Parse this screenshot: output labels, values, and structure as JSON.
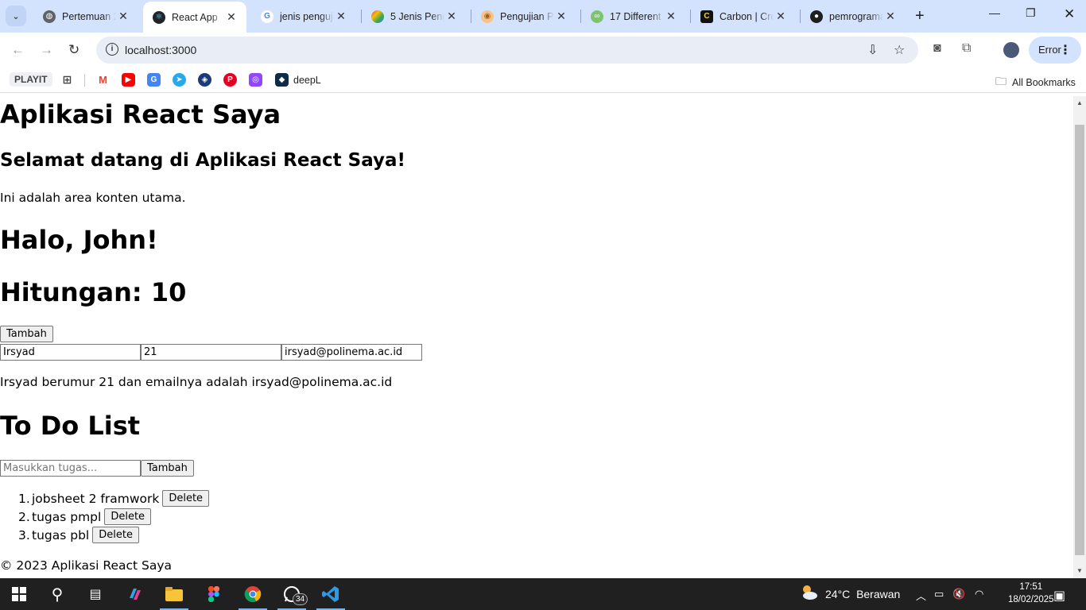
{
  "browser": {
    "tabs": [
      {
        "title": "Pertemuan 2",
        "favicon": "globe-icon",
        "active": false
      },
      {
        "title": "React App",
        "favicon": "react-icon",
        "active": true
      },
      {
        "title": "jenis penguji",
        "favicon": "google-icon",
        "active": false
      },
      {
        "title": "5 Jenis Peng",
        "favicon": "gemini-icon",
        "active": false
      },
      {
        "title": "Pengujian Pe",
        "favicon": "eye-icon",
        "active": false
      },
      {
        "title": "17 Different",
        "favicon": "link-icon",
        "active": false
      },
      {
        "title": "Carbon | Cre",
        "favicon": "carbon-icon",
        "active": false
      },
      {
        "title": "pemrograma",
        "favicon": "github-icon",
        "active": false
      }
    ],
    "url": "localhost:3000",
    "profile_button": "Error",
    "bookmarks": {
      "playit": "PLAYIT",
      "deepl": "deepL",
      "all_bookmarks": "All Bookmarks"
    }
  },
  "app": {
    "title": "Aplikasi React Saya",
    "welcome": "Selamat datang di Aplikasi React Saya!",
    "intro": "Ini adalah area konten utama.",
    "greeting": "Halo, John!",
    "counter": "Hitungan: 10",
    "add_button": "Tambah",
    "form": {
      "name": "Irsyad",
      "age": "21",
      "email": "irsyad@polinema.ac.id"
    },
    "summary": "Irsyad berumur 21 dan emailnya adalah irsyad@polinema.ac.id",
    "todo": {
      "heading": "To Do List",
      "placeholder": "Masukkan tugas...",
      "add_button": "Tambah",
      "delete_label": "Delete",
      "items": [
        {
          "num": "1.",
          "text": "jobsheet 2 framwork"
        },
        {
          "num": "2.",
          "text": "tugas pmpl"
        },
        {
          "num": "3.",
          "text": "tugas pbl"
        }
      ]
    },
    "footer": "© 2023 Aplikasi React Saya"
  },
  "taskbar": {
    "whatsapp_badge": "34",
    "weather_temp": "24°C",
    "weather_desc": "Berawan",
    "time": "17:51",
    "date": "18/02/2025"
  }
}
